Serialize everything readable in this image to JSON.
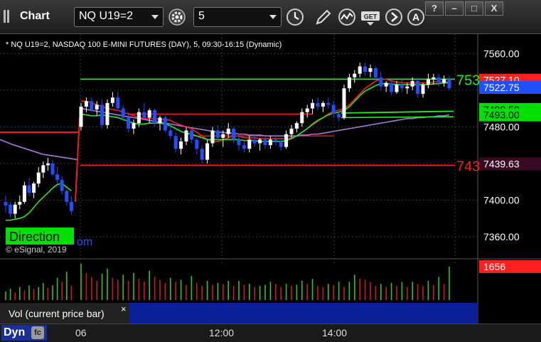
{
  "toolbar": {
    "title": "Chart",
    "symbol": "NQ U19=2",
    "interval": "5",
    "icons": [
      "link-icon",
      "settings-gear-icon",
      "clock-icon",
      "pencil-icon",
      "indicator-icon",
      "get-data-icon",
      "navigate-right-icon",
      "font-size-icon"
    ],
    "window_buttons": [
      "?",
      "–",
      "□",
      "X"
    ]
  },
  "chart_data": {
    "type": "candlestick",
    "title": "* NQ U19=2, NASDAQ 100 E-MINI FUTURES (DAY), 5, 09:30-16:15 (Dynamic)",
    "watermark": "© eSignal, 2019",
    "ylim": [
      7342,
      7575
    ],
    "y_ticks": [
      "7560.00",
      "7520.00",
      "7480.00",
      "7440.00",
      "7400.00",
      "7360.00"
    ],
    "x_ticks": [
      "06",
      "12:00",
      "14:00"
    ],
    "direction_label": "Direction",
    "direction_suffix": "om",
    "price_labels": {
      "last": "7522.75",
      "green_level": "7493.00",
      "green_level_hidden": "7498.50",
      "red_level": "7439.63",
      "top_hidden": "7527.10",
      "green_left_text": "753",
      "red_left_text": "743"
    },
    "colors": {
      "up": "#ffffff",
      "down": "#1f4fff",
      "red_line": "#ff1a1a",
      "green_line": "#26e826",
      "purple_line": "#a07cd6"
    },
    "prev_day": {
      "candles": [
        [
          7398,
          7405,
          7386,
          7394
        ],
        [
          7395,
          7398,
          7381,
          7385
        ],
        [
          7385,
          7398,
          7380,
          7395
        ],
        [
          7395,
          7405,
          7390,
          7398
        ],
        [
          7398,
          7420,
          7396,
          7416
        ],
        [
          7416,
          7424,
          7404,
          7408
        ],
        [
          7408,
          7420,
          7402,
          7418
        ],
        [
          7418,
          7436,
          7414,
          7430
        ],
        [
          7430,
          7442,
          7424,
          7438
        ],
        [
          7438,
          7446,
          7432,
          7440
        ],
        [
          7440,
          7444,
          7426,
          7428
        ],
        [
          7428,
          7436,
          7418,
          7422
        ],
        [
          7422,
          7426,
          7406,
          7410
        ],
        [
          7410,
          7412,
          7394,
          7398
        ],
        [
          7398,
          7404,
          7384,
          7388
        ]
      ],
      "red_line": [
        7474,
        7474
      ],
      "purple_line": [
        7462,
        7444
      ],
      "green_line": [
        7378,
        7378,
        7379,
        7380,
        7382,
        7386,
        7392,
        7398,
        7403,
        7408,
        7413,
        7417,
        7418,
        7414,
        7410
      ]
    },
    "candles": [
      [
        7480,
        7506,
        7476,
        7502
      ],
      [
        7502,
        7512,
        7496,
        7508
      ],
      [
        7508,
        7512,
        7496,
        7499
      ],
      [
        7499,
        7508,
        7492,
        7504
      ],
      [
        7504,
        7510,
        7478,
        7482
      ],
      [
        7482,
        7510,
        7478,
        7506
      ],
      [
        7506,
        7518,
        7502,
        7512
      ],
      [
        7512,
        7518,
        7498,
        7500
      ],
      [
        7500,
        7504,
        7486,
        7490
      ],
      [
        7490,
        7496,
        7474,
        7478
      ],
      [
        7478,
        7488,
        7472,
        7484
      ],
      [
        7484,
        7500,
        7480,
        7496
      ],
      [
        7496,
        7506,
        7488,
        7490
      ],
      [
        7490,
        7500,
        7484,
        7498
      ],
      [
        7498,
        7500,
        7480,
        7484
      ],
      [
        7484,
        7492,
        7476,
        7490
      ],
      [
        7490,
        7492,
        7474,
        7476
      ],
      [
        7476,
        7484,
        7466,
        7470
      ],
      [
        7470,
        7474,
        7452,
        7456
      ],
      [
        7456,
        7468,
        7450,
        7464
      ],
      [
        7464,
        7480,
        7460,
        7476
      ],
      [
        7476,
        7478,
        7462,
        7466
      ],
      [
        7466,
        7468,
        7450,
        7456
      ],
      [
        7456,
        7460,
        7440,
        7444
      ],
      [
        7444,
        7466,
        7440,
        7462
      ],
      [
        7462,
        7480,
        7458,
        7476
      ],
      [
        7476,
        7482,
        7464,
        7468
      ],
      [
        7468,
        7476,
        7458,
        7472
      ],
      [
        7472,
        7484,
        7468,
        7478
      ],
      [
        7478,
        7480,
        7462,
        7466
      ],
      [
        7466,
        7472,
        7454,
        7460
      ],
      [
        7460,
        7464,
        7452,
        7456
      ],
      [
        7456,
        7470,
        7452,
        7466
      ],
      [
        7466,
        7472,
        7458,
        7462
      ],
      [
        7462,
        7468,
        7454,
        7466
      ],
      [
        7466,
        7470,
        7456,
        7460
      ],
      [
        7460,
        7470,
        7456,
        7466
      ],
      [
        7466,
        7472,
        7460,
        7464
      ],
      [
        7464,
        7468,
        7454,
        7458
      ],
      [
        7458,
        7476,
        7456,
        7472
      ],
      [
        7472,
        7482,
        7468,
        7478
      ],
      [
        7478,
        7486,
        7474,
        7484
      ],
      [
        7484,
        7500,
        7480,
        7496
      ],
      [
        7496,
        7504,
        7490,
        7500
      ],
      [
        7500,
        7510,
        7494,
        7506
      ],
      [
        7506,
        7512,
        7498,
        7502
      ],
      [
        7502,
        7508,
        7496,
        7506
      ],
      [
        7506,
        7512,
        7500,
        7504
      ],
      [
        7504,
        7508,
        7490,
        7494
      ],
      [
        7494,
        7500,
        7486,
        7490
      ],
      [
        7490,
        7526,
        7488,
        7522
      ],
      [
        7522,
        7538,
        7518,
        7534
      ],
      [
        7534,
        7542,
        7528,
        7538
      ],
      [
        7538,
        7550,
        7534,
        7546
      ],
      [
        7546,
        7550,
        7536,
        7540
      ],
      [
        7540,
        7548,
        7534,
        7544
      ],
      [
        7544,
        7546,
        7532,
        7534
      ],
      [
        7534,
        7540,
        7520,
        7524
      ],
      [
        7524,
        7530,
        7518,
        7528
      ],
      [
        7528,
        7532,
        7514,
        7518
      ],
      [
        7518,
        7530,
        7516,
        7526
      ],
      [
        7526,
        7532,
        7518,
        7522
      ],
      [
        7522,
        7528,
        7516,
        7524
      ],
      [
        7524,
        7534,
        7520,
        7530
      ],
      [
        7530,
        7534,
        7512,
        7516
      ],
      [
        7516,
        7528,
        7512,
        7526
      ],
      [
        7526,
        7538,
        7522,
        7532
      ],
      [
        7532,
        7538,
        7526,
        7534
      ],
      [
        7534,
        7538,
        7524,
        7528
      ],
      [
        7528,
        7536,
        7524,
        7532
      ],
      [
        7532,
        7536,
        7520,
        7522
      ]
    ],
    "green_ma": [
      7494,
      7493,
      7492,
      7492,
      7493,
      7492,
      7491,
      7490,
      7488,
      7486,
      7484,
      7483,
      7483,
      7484,
      7484,
      7484,
      7483,
      7481,
      7478,
      7475,
      7473,
      7472,
      7470,
      7468,
      7466,
      7466,
      7466,
      7466,
      7466,
      7466,
      7466,
      7465,
      7465,
      7465,
      7464,
      7464,
      7464,
      7464,
      7464,
      7465,
      7467,
      7470,
      7474,
      7478,
      7483,
      7487,
      7490,
      7493,
      7495,
      7496,
      7498,
      7502,
      7508,
      7514,
      7519,
      7522,
      7525,
      7527,
      7527,
      7527,
      7526,
      7526,
      7526,
      7526,
      7526,
      7526,
      7526,
      7527,
      7527,
      7528,
      7528
    ],
    "red_ma": [
      7508,
      7508,
      7506,
      7504,
      7502,
      7500,
      7499,
      7498,
      7496,
      7494,
      7492,
      7490,
      7489,
      7489,
      7489,
      7488,
      7488,
      7487,
      7484,
      7482,
      7480,
      7478,
      7474,
      7470,
      7466,
      7464,
      7464,
      7466,
      7468,
      7470,
      7470,
      7468,
      7468,
      7468,
      7467,
      7467,
      7467,
      7467,
      7467,
      7467,
      7468,
      7470,
      7474,
      7478,
      7482,
      7486,
      7490,
      7494,
      7497,
      7498,
      7500,
      7504,
      7510,
      7516,
      7522,
      7526,
      7530,
      7532,
      7532,
      7530,
      7529,
      7528,
      7528,
      7528,
      7528,
      7528,
      7528,
      7529,
      7529,
      7529,
      7529
    ],
    "purple_line": [
      7500,
      7499,
      7498,
      7497,
      7496,
      7495,
      7494,
      7493,
      7492,
      7491,
      7490,
      7489,
      7488,
      7487,
      7486,
      7485,
      7484,
      7483,
      7482,
      7481,
      7480,
      7479,
      7478,
      7477,
      7476,
      7475,
      7474,
      7474,
      7473,
      7473,
      7472,
      7472,
      7471,
      7471,
      7471,
      7470,
      7470,
      7470,
      7470,
      7470,
      7470,
      7470,
      7471,
      7471,
      7472,
      7472,
      7473,
      7474,
      7475,
      7476,
      7477,
      7478,
      7479,
      7480,
      7481,
      7482,
      7483,
      7484,
      7485,
      7486,
      7487,
      7488,
      7489,
      7489,
      7490,
      7490,
      7491,
      7491,
      7492,
      7492,
      7493
    ],
    "flat_green_line": 7532,
    "flat_red_line": 7494,
    "red_sweep": [
      7474,
      7508,
      7505,
      7499,
      7488,
      7477
    ],
    "volume_pane": {
      "label": "Vol (current price bar)",
      "close_glyph": "×",
      "value": "1656",
      "bars_prev": [
        420,
        560,
        380,
        650,
        480,
        720,
        560,
        640,
        840,
        600,
        720,
        1100,
        900,
        1400,
        700
      ],
      "bars": [
        1800,
        1350,
        1150,
        950,
        1300,
        1550,
        1100,
        1000,
        1250,
        950,
        1350,
        1050,
        900,
        1450,
        1150,
        1000,
        850,
        1100,
        900,
        1000,
        750,
        1200,
        850,
        700,
        950,
        750,
        850,
        800,
        950,
        700,
        950,
        750,
        800,
        650,
        700,
        750,
        900,
        800,
        650,
        800,
        700,
        750,
        950,
        800,
        1050,
        700,
        650,
        800,
        750,
        900,
        650,
        900,
        1250,
        1050,
        1000,
        900,
        700,
        800,
        650,
        850,
        700,
        900,
        650,
        900,
        800,
        700,
        950,
        750,
        1150,
        800,
        1656
      ]
    }
  }
}
